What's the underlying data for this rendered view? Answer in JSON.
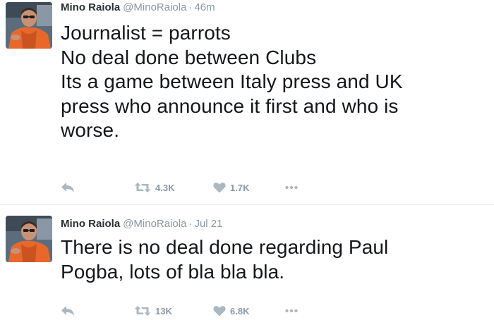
{
  "tweets": [
    {
      "fullname": "Mino Raiola",
      "username": "@MinoRaiola",
      "separator": "·",
      "time": "46m",
      "text_lines": [
        "Journalist = parrots",
        "No deal done between Clubs",
        "Its a game between Italy press and UK",
        "press who announce it first and who is",
        "worse."
      ],
      "retweet_count": "4.3K",
      "like_count": "1.7K"
    },
    {
      "fullname": "Mino Raiola",
      "username": "@MinoRaiola",
      "separator": "·",
      "time": "Jul 21",
      "text_lines": [
        "There is no deal done regarding Paul",
        "Pogba, lots of bla bla bla."
      ],
      "retweet_count": "13K",
      "like_count": "6.8K"
    }
  ],
  "colors": {
    "name": "#292f33",
    "meta": "#8899a6",
    "text": "#14171a",
    "icon": "#aab8c2",
    "divider": "#e1e8ed",
    "avatar_jacket": "#e8682c"
  },
  "icons": {
    "reply": "reply-icon",
    "retweet": "retweet-icon",
    "like": "heart-icon",
    "more": "more-dots-icon"
  }
}
